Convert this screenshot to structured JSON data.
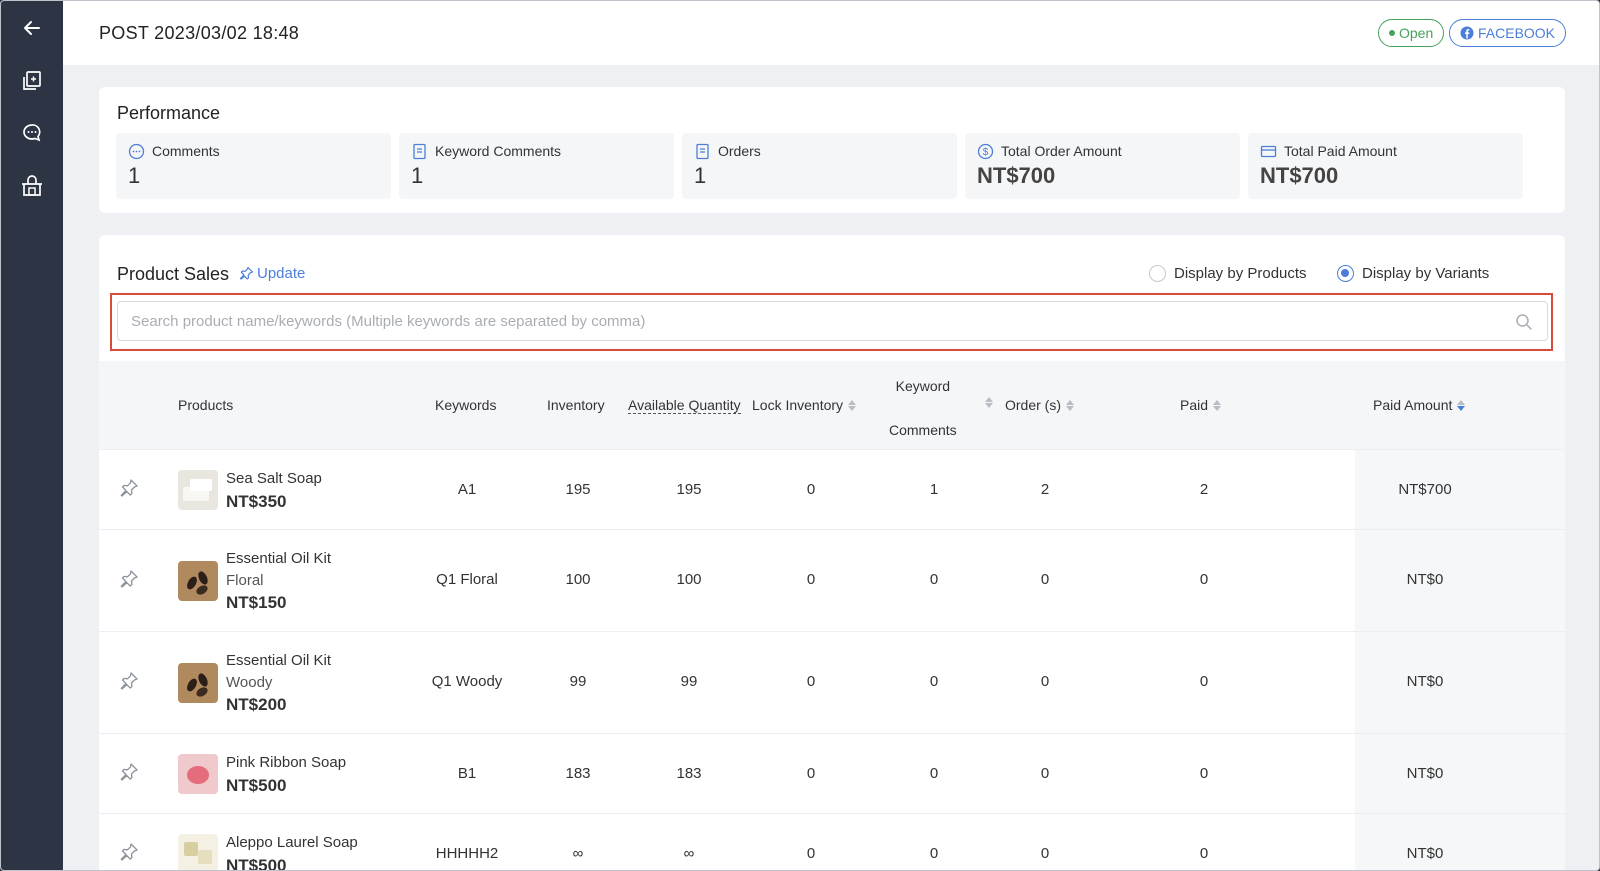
{
  "header": {
    "post_title": "POST 2023/03/02 18:48",
    "status_label": "Open",
    "platform_label": "FACEBOOK"
  },
  "sidebar": {
    "icons": [
      "back-arrow-icon",
      "posts-icon",
      "chat-icon",
      "store-icon"
    ]
  },
  "performance": {
    "title": "Performance",
    "stats": [
      {
        "label": "Comments",
        "value": "1",
        "icon": "comment-icon"
      },
      {
        "label": "Keyword Comments",
        "value": "1",
        "icon": "document-icon"
      },
      {
        "label": "Orders",
        "value": "1",
        "icon": "document-icon"
      },
      {
        "label": "Total Order Amount",
        "value": "NT$700",
        "icon": "dollar-icon"
      },
      {
        "label": "Total Paid Amount",
        "value": "NT$700",
        "icon": "card-icon"
      }
    ]
  },
  "product_sales": {
    "title": "Product Sales",
    "update_label": "Update",
    "display_by_products": "Display by Products",
    "display_by_variants": "Display by Variants",
    "selected_display": "Display by Variants",
    "search_placeholder": "Search product name/keywords (Multiple keywords are separated by comma)",
    "columns": {
      "products": "Products",
      "keywords": "Keywords",
      "inventory": "Inventory",
      "available_quantity": "Available Quantity",
      "lock_inventory": "Lock Inventory",
      "keyword_comments_line1": "Keyword",
      "keyword_comments_line2": "Comments",
      "orders": "Order (s)",
      "paid": "Paid",
      "paid_amount": "Paid Amount"
    },
    "rows": [
      {
        "name": "Sea Salt Soap",
        "variant": "",
        "price": "NT$350",
        "keyword": "A1",
        "inventory": "195",
        "available": "195",
        "lock": "0",
        "keyword_comments": "1",
        "orders": "2",
        "paid": "2",
        "paid_amount": "NT$700",
        "thumb_color": "#e9e6e0"
      },
      {
        "name": "Essential Oil Kit",
        "variant": "Floral",
        "price": "NT$150",
        "keyword": "Q1 Floral",
        "inventory": "100",
        "available": "100",
        "lock": "0",
        "keyword_comments": "0",
        "orders": "0",
        "paid": "0",
        "paid_amount": "NT$0",
        "thumb_color": "#b08a5e"
      },
      {
        "name": "Essential Oil Kit",
        "variant": "Woody",
        "price": "NT$200",
        "keyword": "Q1 Woody",
        "inventory": "99",
        "available": "99",
        "lock": "0",
        "keyword_comments": "0",
        "orders": "0",
        "paid": "0",
        "paid_amount": "NT$0",
        "thumb_color": "#b08a5e"
      },
      {
        "name": "Pink Ribbon Soap",
        "variant": "",
        "price": "NT$500",
        "keyword": "B1",
        "inventory": "183",
        "available": "183",
        "lock": "0",
        "keyword_comments": "0",
        "orders": "0",
        "paid": "0",
        "paid_amount": "NT$0",
        "thumb_color": "#e38c95"
      },
      {
        "name": "Aleppo Laurel Soap",
        "variant": "",
        "price": "NT$500",
        "keyword": "HHHHH2",
        "inventory": "∞",
        "available": "∞",
        "lock": "0",
        "keyword_comments": "0",
        "orders": "0",
        "paid": "0",
        "paid_amount": "NT$0",
        "thumb_color": "#ddd6b8"
      }
    ]
  },
  "colors": {
    "sidebar": "#2d3444",
    "accent": "#4b7ed9",
    "open_green": "#46a15c",
    "highlight_red": "#d94a38"
  }
}
